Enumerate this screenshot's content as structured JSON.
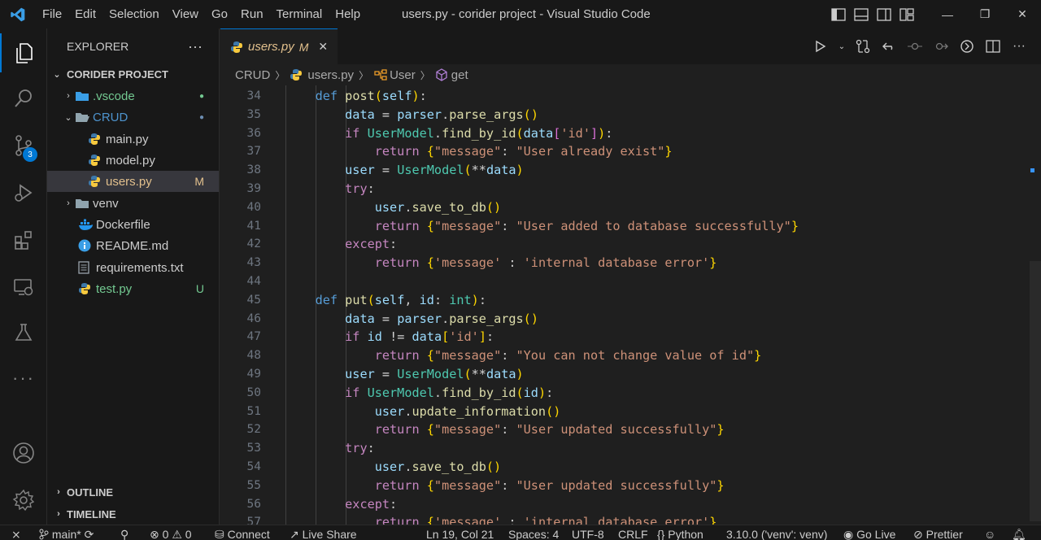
{
  "titlebar": {
    "menu": [
      "File",
      "Edit",
      "Selection",
      "View",
      "Go",
      "Run",
      "Terminal",
      "Help"
    ],
    "title": "users.py - corider project - Visual Studio Code"
  },
  "activity": {
    "scm_badge": "3"
  },
  "sidebar": {
    "header": "EXPLORER",
    "more": "···",
    "project": "CORIDER PROJECT",
    "items": [
      {
        "label": ".vscode",
        "status": "●"
      },
      {
        "label": "CRUD",
        "status": "●"
      },
      {
        "label": "main.py",
        "status": ""
      },
      {
        "label": "model.py",
        "status": ""
      },
      {
        "label": "users.py",
        "status": "M"
      },
      {
        "label": "venv",
        "status": ""
      },
      {
        "label": "Dockerfile",
        "status": ""
      },
      {
        "label": "README.md",
        "status": ""
      },
      {
        "label": "requirements.txt",
        "status": ""
      },
      {
        "label": "test.py",
        "status": "U"
      }
    ],
    "outline": "OUTLINE",
    "timeline": "TIMELINE"
  },
  "tab": {
    "name": "users.py",
    "modified": "M",
    "close": "✕"
  },
  "breadcrumb": [
    "CRUD",
    "users.py",
    "User",
    "get"
  ],
  "editor": {
    "line_numbers": [
      "34",
      "35",
      "36",
      "37",
      "38",
      "39",
      "40",
      "41",
      "42",
      "43",
      "44",
      "45",
      "46",
      "47",
      "48",
      "49",
      "50",
      "51",
      "52",
      "53",
      "54",
      "55",
      "56",
      "57"
    ]
  },
  "statusbar": {
    "branch": "main*",
    "errors": "0",
    "warnings": "0",
    "connect": "Connect",
    "liveshare": "Live Share",
    "cursor": "Ln 19, Col 21",
    "spaces": "Spaces: 4",
    "encoding": "UTF-8",
    "eol": "CRLF",
    "braces": "{}",
    "language": "Python",
    "interpreter": "3.10.0 ('venv': venv)",
    "golive": "Go Live",
    "prettier": "Prettier"
  },
  "colors": {
    "accent": "#0078d4",
    "modified": "#e2c08d",
    "untracked": "#73c991",
    "folder_blue": "#4e94ce"
  }
}
